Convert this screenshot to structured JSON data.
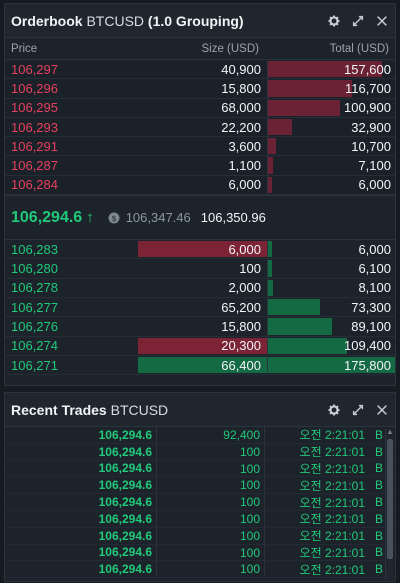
{
  "orderbook": {
    "title": "Orderbook",
    "symbol": "BTCUSD",
    "grouping": "(1.0 Grouping)",
    "columns": {
      "price": "Price",
      "size": "Size (USD)",
      "total": "Total (USD)"
    },
    "asks": [
      {
        "price": "106,297",
        "size": "40,900",
        "total": "157,600",
        "size_frac": 0.0,
        "total_frac": 0.9
      },
      {
        "price": "106,296",
        "size": "15,800",
        "total": "116,700",
        "size_frac": 0.0,
        "total_frac": 0.66
      },
      {
        "price": "106,295",
        "size": "68,000",
        "total": "100,900",
        "size_frac": 0.0,
        "total_frac": 0.57
      },
      {
        "price": "106,293",
        "size": "22,200",
        "total": "32,900",
        "size_frac": 0.0,
        "total_frac": 0.19
      },
      {
        "price": "106,291",
        "size": "3,600",
        "total": "10,700",
        "size_frac": 0.0,
        "total_frac": 0.06
      },
      {
        "price": "106,287",
        "size": "1,100",
        "total": "7,100",
        "size_frac": 0.0,
        "total_frac": 0.04
      },
      {
        "price": "106,284",
        "size": "6,000",
        "total": "6,000",
        "size_frac": 0.0,
        "total_frac": 0.03
      }
    ],
    "mid": {
      "last": "106,294.6",
      "arrow": "↑",
      "mark": "106,347.46",
      "index": "106,350.96"
    },
    "bids": [
      {
        "price": "106,283",
        "size": "6,000",
        "total": "6,000",
        "size_frac": 0.78,
        "total_frac": 0.03
      },
      {
        "price": "106,280",
        "size": "100",
        "total": "6,100",
        "size_frac": 0.0,
        "total_frac": 0.03
      },
      {
        "price": "106,278",
        "size": "2,000",
        "total": "8,100",
        "size_frac": 0.0,
        "total_frac": 0.04
      },
      {
        "price": "106,277",
        "size": "65,200",
        "total": "73,300",
        "size_frac": 0.0,
        "total_frac": 0.41
      },
      {
        "price": "106,276",
        "size": "15,800",
        "total": "89,100",
        "size_frac": 0.0,
        "total_frac": 0.5
      },
      {
        "price": "106,274",
        "size": "20,300",
        "total": "109,400",
        "size_frac": 0.78,
        "total_frac": 0.62
      },
      {
        "price": "106,271",
        "size": "66,400",
        "total": "175,800",
        "size_frac": 0.78,
        "total_frac": 1.0,
        "size_green": true
      }
    ]
  },
  "trades": {
    "title": "Recent Trades",
    "symbol": "BTCUSD",
    "rows": [
      {
        "price": "106,294.6",
        "size": "92,400",
        "time": "오전 2:21:01",
        "side": "B"
      },
      {
        "price": "106,294.6",
        "size": "100",
        "time": "오전 2:21:01",
        "side": "B"
      },
      {
        "price": "106,294.6",
        "size": "100",
        "time": "오전 2:21:01",
        "side": "B"
      },
      {
        "price": "106,294.6",
        "size": "100",
        "time": "오전 2:21:01",
        "side": "B"
      },
      {
        "price": "106,294.6",
        "size": "100",
        "time": "오전 2:21:01",
        "side": "B"
      },
      {
        "price": "106,294.6",
        "size": "100",
        "time": "오전 2:21:01",
        "side": "B"
      },
      {
        "price": "106,294.6",
        "size": "100",
        "time": "오전 2:21:01",
        "side": "B"
      },
      {
        "price": "106,294.6",
        "size": "100",
        "time": "오전 2:21:01",
        "side": "B"
      },
      {
        "price": "106,294.6",
        "size": "100",
        "time": "오전 2:21:01",
        "side": "B"
      }
    ]
  },
  "icons": {
    "settings": "gear-icon",
    "expand": "expand-icon",
    "close": "close-icon",
    "mark_price": "mark-price-icon"
  },
  "colors": {
    "ask": "#e5405e",
    "bid": "#21c97a",
    "ask_bar": "#6b2234",
    "bid_bar": "#136a43",
    "bg": "#161b21"
  }
}
